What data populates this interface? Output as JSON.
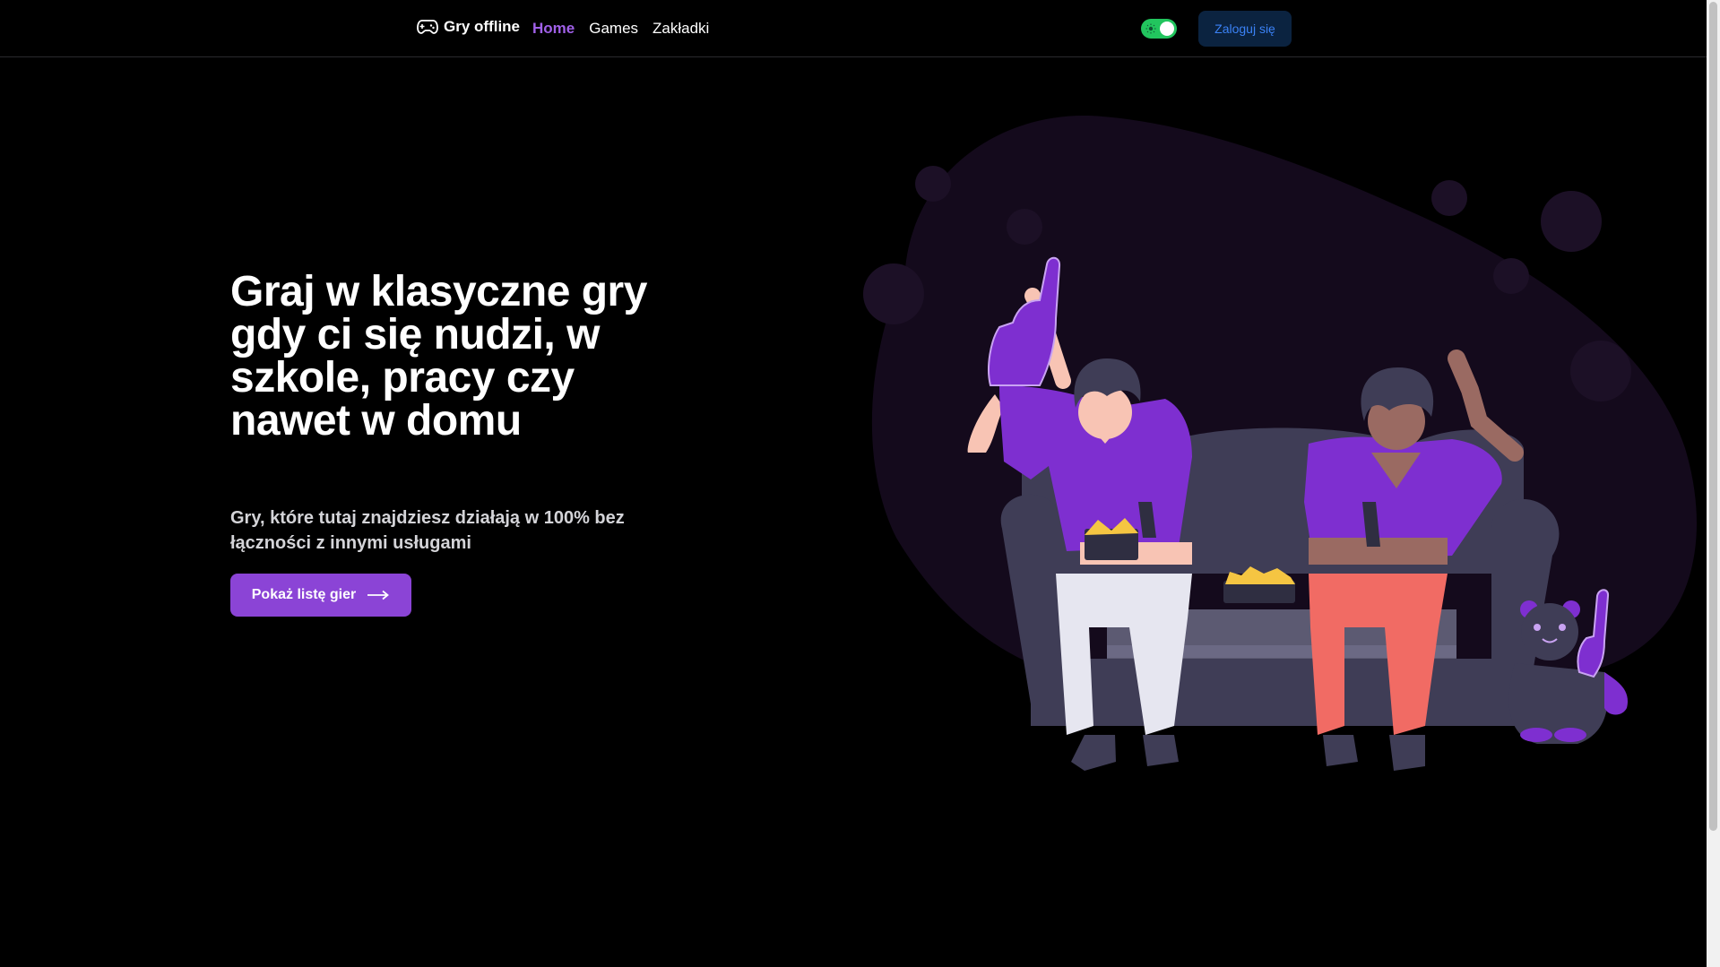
{
  "navbar": {
    "brand": "Gry offline",
    "links": [
      {
        "label": "Home",
        "active": true
      },
      {
        "label": "Games",
        "active": false
      },
      {
        "label": "Zakładki",
        "active": false
      }
    ],
    "theme_toggle_on": true,
    "login_label": "Zaloguj się"
  },
  "hero": {
    "title": "Graj w klasyczne gry gdy ci się nudzi, w szkole, pracy czy nawet w domu",
    "subtitle": "Gry, które tutaj znajdziesz działają w 100% bez łączności z innymi usługami",
    "cta_label": "Pokaż listę gier"
  },
  "colors": {
    "accent": "#8b44d6",
    "active_link": "#a060e8",
    "toggle": "#22c55e",
    "login_bg": "#0b2340",
    "login_text": "#3b82f6",
    "blob": "#140a1c"
  },
  "icons": {
    "brand": "gamepad-icon",
    "cta": "arrow-right-icon",
    "toggle": "sun-icon"
  }
}
